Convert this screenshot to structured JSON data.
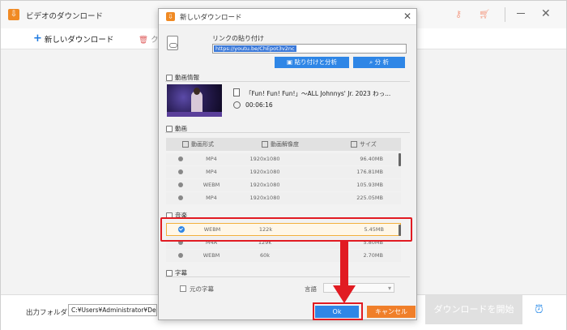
{
  "app": {
    "title": "ビデオのダウンロード",
    "toolbar": {
      "add_label": "新しいダウンロード",
      "clear_label": "ク"
    },
    "bottom": {
      "folder_label": "出力フォルダ：",
      "folder_value": "C:¥Users¥Administrator¥Desktop",
      "download_all_label": "ダウンロードを開始"
    },
    "icons": {
      "key": "key-icon",
      "cart": "cart-icon",
      "alarm": "alarm-clock-icon"
    }
  },
  "dialog": {
    "title": "新しいダウンロード",
    "link_label": "リンクの貼り付け",
    "url_value": "https://youtu.be/ChEpot3v2nc",
    "paste_analyze_label": "貼り付けと分析",
    "analyze_label": "分 析",
    "video_info": {
      "section_label": "動画情報",
      "title": "「Fun! Fun! Fun!」～ALL Johnnys' Jr. 2023 わっ...",
      "duration": "00:06:16"
    },
    "video": {
      "section_label": "動画",
      "headers": [
        "動画形式",
        "動画解像度",
        "サイズ"
      ],
      "rows": [
        {
          "format": "MP4",
          "resolution": "1920x1080",
          "size": "96.40MB"
        },
        {
          "format": "MP4",
          "resolution": "1920x1080",
          "size": "176.81MB"
        },
        {
          "format": "WEBM",
          "resolution": "1920x1080",
          "size": "105.93MB"
        },
        {
          "format": "MP4",
          "resolution": "1920x1080",
          "size": "225.05MB"
        }
      ]
    },
    "audio": {
      "section_label": "音楽",
      "rows": [
        {
          "format": "WEBM",
          "bitrate": "122k",
          "size": "5.45MB",
          "selected": true
        },
        {
          "format": "M4A",
          "bitrate": "129k",
          "size": "5.80MB",
          "selected": false
        },
        {
          "format": "WEBM",
          "bitrate": "60k",
          "size": "2.70MB",
          "selected": false
        }
      ]
    },
    "subtitle": {
      "section_label": "字幕",
      "original_label": "元の字幕",
      "language_label": "言語"
    },
    "ok_label": "Ok",
    "cancel_label": "キャンセル"
  },
  "colors": {
    "accent_blue": "#2f86e6",
    "cancel_orange": "#f07f2a",
    "highlight_red": "#e11b22"
  }
}
